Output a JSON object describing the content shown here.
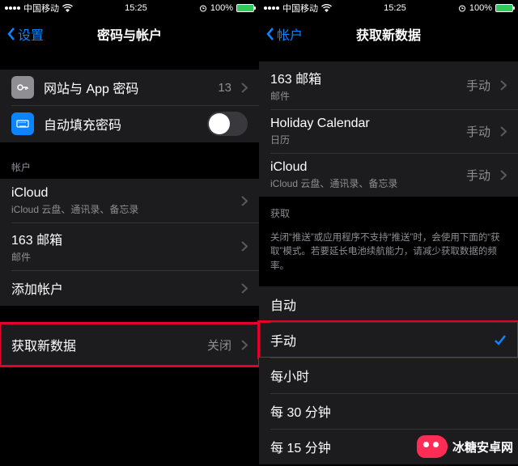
{
  "left": {
    "status": {
      "carrier": "中国移动",
      "time": "15:25",
      "battery_pct": "100%"
    },
    "nav": {
      "back": "设置",
      "title": "密码与帐户"
    },
    "passwords": {
      "web_app_label": "网站与 App 密码",
      "web_app_count": "13",
      "autofill_label": "自动填充密码"
    },
    "accounts_header": "帐户",
    "accounts": [
      {
        "label": "iCloud",
        "sub": "iCloud 云盘、通讯录、备忘录"
      },
      {
        "label": "163 邮箱",
        "sub": "邮件"
      }
    ],
    "add_account": "添加帐户",
    "fetch": {
      "label": "获取新数据",
      "value": "关闭"
    }
  },
  "right": {
    "status": {
      "carrier": "中国移动",
      "time": "15:25",
      "battery_pct": "100%"
    },
    "nav": {
      "back": "帐户",
      "title": "获取新数据"
    },
    "accounts": [
      {
        "label": "163 邮箱",
        "sub": "邮件",
        "value": "手动"
      },
      {
        "label": "Holiday Calendar",
        "sub": "日历",
        "value": "手动"
      },
      {
        "label": "iCloud",
        "sub": "iCloud 云盘、通讯录、备忘录",
        "value": "手动"
      }
    ],
    "fetch_header": "获取",
    "fetch_footer": "关闭“推送”或应用程序不支持“推送”时，会使用下面的“获取”模式。若要延长电池续航能力，请减少获取数据的频率。",
    "options": [
      {
        "label": "自动",
        "selected": false
      },
      {
        "label": "手动",
        "selected": true
      },
      {
        "label": "每小时",
        "selected": false
      },
      {
        "label": "每 30 分钟",
        "selected": false
      },
      {
        "label": "每 15 分钟",
        "selected": false
      }
    ]
  },
  "watermark": "冰糖安卓网"
}
